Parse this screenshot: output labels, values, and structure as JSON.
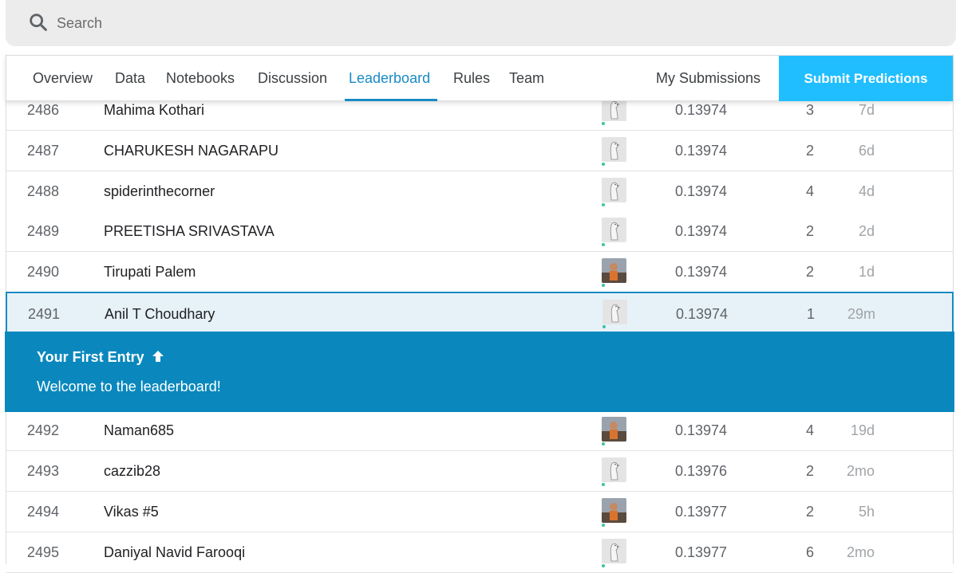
{
  "search": {
    "placeholder": "Search"
  },
  "tabs": [
    {
      "label": "Overview",
      "active": false
    },
    {
      "label": "Data",
      "active": false
    },
    {
      "label": "Notebooks",
      "active": false
    },
    {
      "label": "Discussion",
      "active": false
    },
    {
      "label": "Leaderboard",
      "active": true
    },
    {
      "label": "Rules",
      "active": false
    },
    {
      "label": "Team",
      "active": false
    }
  ],
  "my_submissions_label": "My Submissions",
  "submit_label": "Submit Predictions",
  "colors": {
    "accent": "#20beff",
    "active_tab": "#1a8ac4",
    "banner": "#0a88bd",
    "highlight_bg": "#e6f2f8"
  },
  "rows": [
    {
      "rank": "2486",
      "name": "Mahima Kothari",
      "score": "0.13974",
      "entries": "3",
      "last": "7d",
      "avatar": "default-avatar"
    },
    {
      "rank": "2487",
      "name": "CHARUKESH NAGARAPU",
      "score": "0.13974",
      "entries": "2",
      "last": "6d",
      "avatar": "default-avatar"
    },
    {
      "rank": "2488",
      "name": "spiderinthecorner",
      "score": "0.13974",
      "entries": "4",
      "last": "4d",
      "avatar": "default-avatar"
    },
    {
      "rank": "2489",
      "name": "PREETISHA SRIVASTAVA",
      "score": "0.13974",
      "entries": "2",
      "last": "2d",
      "avatar": "default-avatar"
    },
    {
      "rank": "2490",
      "name": "Tirupati Palem",
      "score": "0.13974",
      "entries": "2",
      "last": "1d",
      "avatar": "photo-avatar"
    },
    {
      "rank": "2491",
      "name": "Anil T Choudhary",
      "score": "0.13974",
      "entries": "1",
      "last": "29m",
      "avatar": "default-avatar"
    },
    {
      "rank": "2492",
      "name": "Naman685",
      "score": "0.13974",
      "entries": "4",
      "last": "19d",
      "avatar": "photo-avatar"
    },
    {
      "rank": "2493",
      "name": "cazzib28",
      "score": "0.13976",
      "entries": "2",
      "last": "2mo",
      "avatar": "default-avatar"
    },
    {
      "rank": "2494",
      "name": "Vikas #5",
      "score": "0.13977",
      "entries": "2",
      "last": "5h",
      "avatar": "photo-avatar"
    },
    {
      "rank": "2495",
      "name": "Daniyal Navid Farooqi",
      "score": "0.13977",
      "entries": "6",
      "last": "2mo",
      "avatar": "default-avatar"
    }
  ],
  "banner": {
    "title": "Your First Entry",
    "message": "Welcome to the leaderboard!"
  }
}
